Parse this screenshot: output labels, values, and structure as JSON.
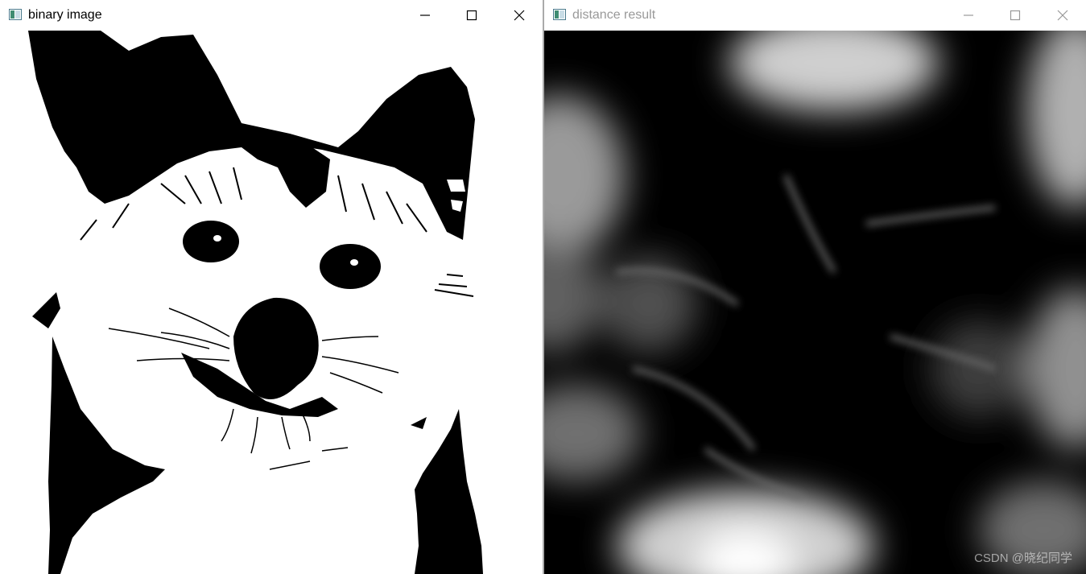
{
  "windows": [
    {
      "title": "binary image",
      "state": "active",
      "content": "binary threshold image of a dog (black and white)"
    },
    {
      "title": "distance result",
      "state": "inactive",
      "content": "distance transform result (grayscale glow)"
    }
  ],
  "controls": {
    "minimize_icon": "minimize-icon",
    "maximize_icon": "maximize-icon",
    "close_icon": "close-icon"
  },
  "watermark": "CSDN @晓纪同学",
  "colors": {
    "title_active": "#000000",
    "title_inactive": "#999999",
    "divider": "#aaaaaa"
  }
}
